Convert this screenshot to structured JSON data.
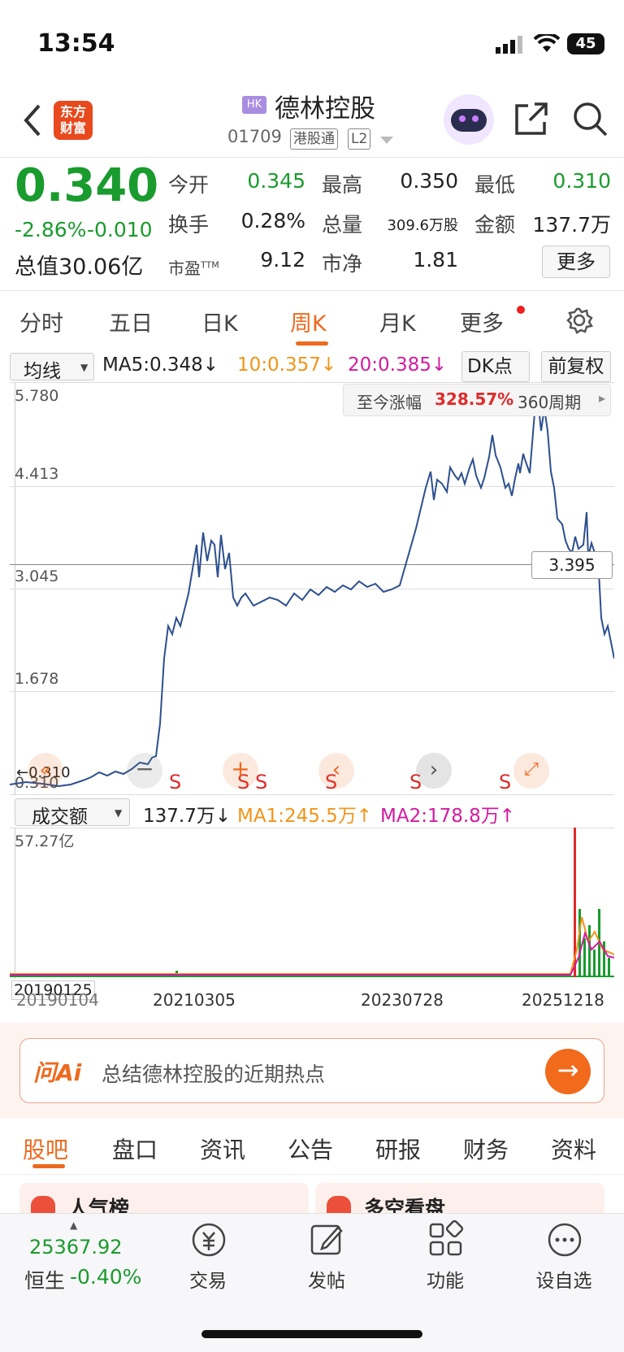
{
  "status_bar": {
    "time": "13:54",
    "battery": "45"
  },
  "header": {
    "logo_line1": "东方",
    "logo_line2": "财富",
    "market_tag": "HK",
    "stock_name": "德林控股",
    "stock_code": "01709",
    "connect_tag": "港股通",
    "level_tag": "L2"
  },
  "quote": {
    "price": "0.340",
    "change_pct": "-2.86%",
    "change_abs": "-0.010",
    "market_cap": "总值30.06亿",
    "open_label": "今开",
    "open": "0.345",
    "high_label": "最高",
    "high": "0.350",
    "low_label": "最低",
    "low": "0.310",
    "turnover_label": "换手",
    "turnover": "0.28%",
    "volume_label": "总量",
    "volume": "309.6万股",
    "amount_label": "金额",
    "amount": "137.7万",
    "pe_label": "市盈",
    "pe_sup": "TTM",
    "pe": "9.12",
    "pb_label": "市净",
    "pb": "1.81",
    "more_btn": "更多"
  },
  "chart_tabs": [
    "分时",
    "五日",
    "日K",
    "周K",
    "月K",
    "更多"
  ],
  "active_tab": "周K",
  "ma_row": {
    "selector": "均线",
    "ma5": "MA5:0.348↓",
    "ma10": "10:0.357↓",
    "ma20": "20:0.385↓",
    "dk_btn": "DK点",
    "adjust_btn": "前复权"
  },
  "range_info": {
    "label": "至今涨幅",
    "value": "328.57%",
    "period": "360周期"
  },
  "price_axis": [
    "5.780",
    "4.413",
    "3.045",
    "1.678",
    "0.310"
  ],
  "cursor_price": "3.395",
  "low_marker": "←0.310",
  "signal_marks": [
    "S",
    "S",
    "S",
    "S",
    "S",
    "S"
  ],
  "volume_row": {
    "selector": "成交额",
    "current": "137.7万↓",
    "ma1": "MA1:245.5万↑",
    "ma2": "MA2:178.8万↑"
  },
  "volume_max": "57.27亿",
  "date_axis": [
    "20190125",
    "20190104",
    "20210305",
    "20230728",
    "20251218"
  ],
  "ai_box": {
    "brand": "问Ai",
    "text": "总结德林控股的近期热点"
  },
  "sub_tabs": [
    "股吧",
    "盘口",
    "资讯",
    "公告",
    "研报",
    "财务",
    "资料"
  ],
  "active_sub_tab": "股吧",
  "peek": {
    "left": "人气榜",
    "right": "多空看盘"
  },
  "bottom_bar": {
    "index_value": "25367.92",
    "index_name": "恒生",
    "index_change": "-0.40%",
    "items": [
      "交易",
      "发帖",
      "功能",
      "设自选"
    ]
  },
  "colors": {
    "up": "#e02a2a",
    "down": "#1a9b2e",
    "accent": "#ee6a1f",
    "line": "#2c4f8f"
  }
}
